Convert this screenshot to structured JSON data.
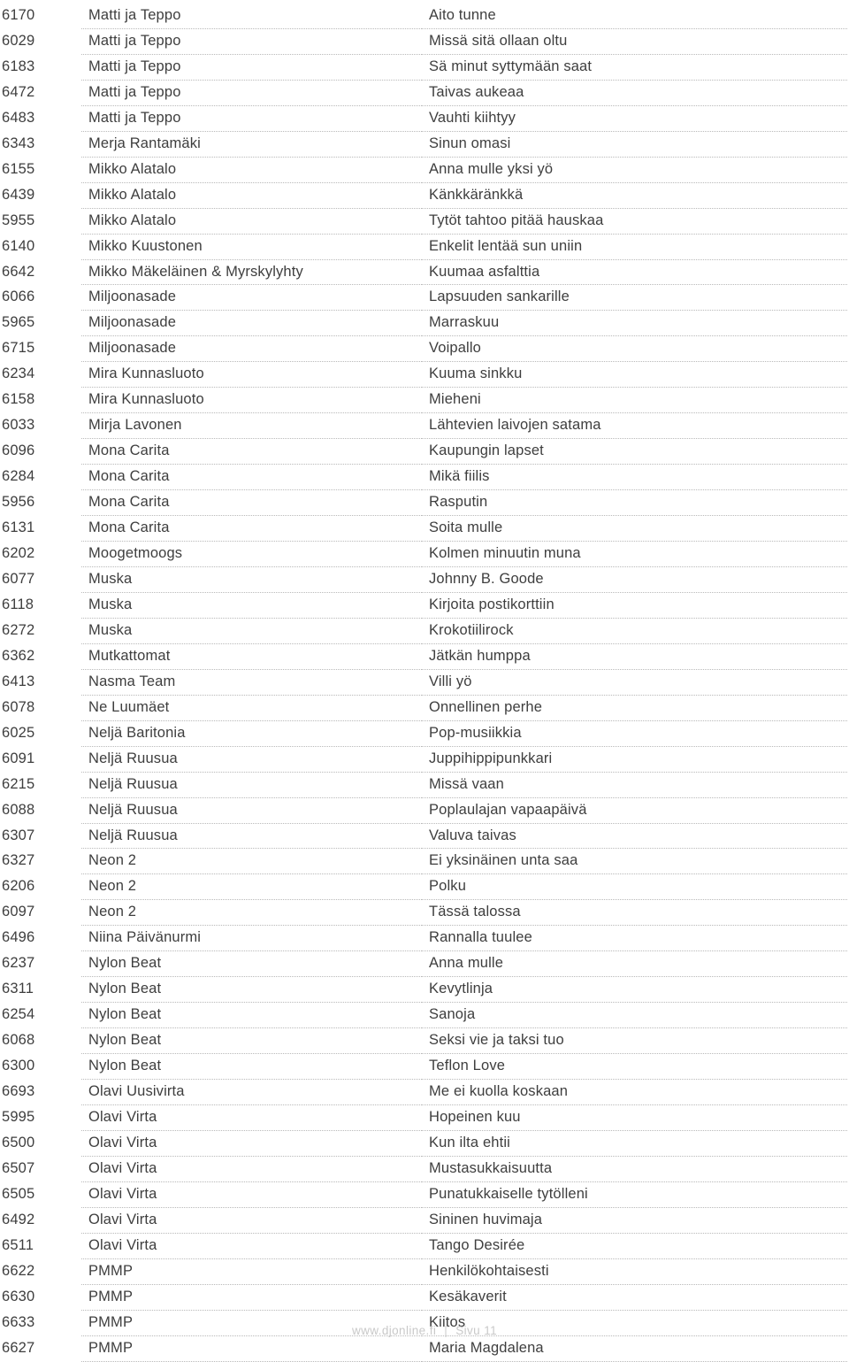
{
  "document": {
    "type": "karaoke-song-catalog",
    "columns": [
      "code",
      "artist",
      "title"
    ]
  },
  "rows": [
    {
      "code": "6170",
      "artist": "Matti ja Teppo",
      "title": "Aito tunne"
    },
    {
      "code": "6029",
      "artist": "Matti ja Teppo",
      "title": "Missä sitä ollaan oltu"
    },
    {
      "code": "6183",
      "artist": "Matti ja Teppo",
      "title": "Sä minut syttymään saat"
    },
    {
      "code": "6472",
      "artist": "Matti ja Teppo",
      "title": "Taivas aukeaa"
    },
    {
      "code": "6483",
      "artist": "Matti ja Teppo",
      "title": "Vauhti kiihtyy"
    },
    {
      "code": "6343",
      "artist": "Merja Rantamäki",
      "title": "Sinun omasi"
    },
    {
      "code": "6155",
      "artist": "Mikko Alatalo",
      "title": "Anna mulle yksi yö"
    },
    {
      "code": "6439",
      "artist": "Mikko Alatalo",
      "title": "Känkkäränkkä"
    },
    {
      "code": "5955",
      "artist": "Mikko Alatalo",
      "title": "Tytöt tahtoo pitää hauskaa"
    },
    {
      "code": "6140",
      "artist": "Mikko Kuustonen",
      "title": "Enkelit lentää sun uniin"
    },
    {
      "code": "6642",
      "artist": "Mikko Mäkeläinen & Myrskylyhty",
      "title": "Kuumaa asfalttia"
    },
    {
      "code": "6066",
      "artist": "Miljoonasade",
      "title": "Lapsuuden sankarille"
    },
    {
      "code": "5965",
      "artist": "Miljoonasade",
      "title": "Marraskuu"
    },
    {
      "code": "6715",
      "artist": "Miljoonasade",
      "title": "Voipallo"
    },
    {
      "code": "6234",
      "artist": "Mira Kunnasluoto",
      "title": "Kuuma sinkku"
    },
    {
      "code": "6158",
      "artist": "Mira Kunnasluoto",
      "title": "Mieheni"
    },
    {
      "code": "6033",
      "artist": "Mirja Lavonen",
      "title": "Lähtevien laivojen satama"
    },
    {
      "code": "6096",
      "artist": "Mona Carita",
      "title": "Kaupungin lapset"
    },
    {
      "code": "6284",
      "artist": "Mona Carita",
      "title": "Mikä fiilis"
    },
    {
      "code": "5956",
      "artist": "Mona Carita",
      "title": "Rasputin"
    },
    {
      "code": "6131",
      "artist": "Mona Carita",
      "title": "Soita mulle"
    },
    {
      "code": "6202",
      "artist": "Moogetmoogs",
      "title": "Kolmen minuutin muna"
    },
    {
      "code": "6077",
      "artist": "Muska",
      "title": "Johnny B. Goode"
    },
    {
      "code": "6118",
      "artist": "Muska",
      "title": "Kirjoita postikorttiin"
    },
    {
      "code": "6272",
      "artist": "Muska",
      "title": "Krokotiilirock"
    },
    {
      "code": "6362",
      "artist": "Mutkattomat",
      "title": "Jätkän humppa"
    },
    {
      "code": "6413",
      "artist": "Nasma Team",
      "title": "Villi yö"
    },
    {
      "code": "6078",
      "artist": "Ne Luumäet",
      "title": "Onnellinen perhe"
    },
    {
      "code": "6025",
      "artist": "Neljä Baritonia",
      "title": "Pop-musiikkia"
    },
    {
      "code": "6091",
      "artist": "Neljä Ruusua",
      "title": "Juppihippipunkkari"
    },
    {
      "code": "6215",
      "artist": "Neljä Ruusua",
      "title": "Missä vaan"
    },
    {
      "code": "6088",
      "artist": "Neljä Ruusua",
      "title": "Poplaulajan vapaapäivä"
    },
    {
      "code": "6307",
      "artist": "Neljä Ruusua",
      "title": "Valuva taivas"
    },
    {
      "code": "6327",
      "artist": "Neon 2",
      "title": "Ei yksinäinen unta saa"
    },
    {
      "code": "6206",
      "artist": "Neon 2",
      "title": "Polku"
    },
    {
      "code": "6097",
      "artist": "Neon 2",
      "title": "Tässä talossa"
    },
    {
      "code": "6496",
      "artist": "Niina Päivänurmi",
      "title": "Rannalla tuulee"
    },
    {
      "code": "6237",
      "artist": "Nylon Beat",
      "title": "Anna mulle"
    },
    {
      "code": "6311",
      "artist": "Nylon Beat",
      "title": "Kevytlinja"
    },
    {
      "code": "6254",
      "artist": "Nylon Beat",
      "title": "Sanoja"
    },
    {
      "code": "6068",
      "artist": "Nylon Beat",
      "title": "Seksi vie ja taksi tuo"
    },
    {
      "code": "6300",
      "artist": "Nylon Beat",
      "title": "Teflon Love"
    },
    {
      "code": "6693",
      "artist": "Olavi Uusivirta",
      "title": "Me ei kuolla koskaan"
    },
    {
      "code": "5995",
      "artist": "Olavi Virta",
      "title": "Hopeinen kuu"
    },
    {
      "code": "6500",
      "artist": "Olavi Virta",
      "title": "Kun ilta ehtii"
    },
    {
      "code": "6507",
      "artist": "Olavi Virta",
      "title": "Mustasukkaisuutta"
    },
    {
      "code": "6505",
      "artist": "Olavi Virta",
      "title": "Punatukkaiselle tytölleni"
    },
    {
      "code": "6492",
      "artist": "Olavi Virta",
      "title": "Sininen huvimaja"
    },
    {
      "code": "6511",
      "artist": "Olavi Virta",
      "title": "Tango Desirée"
    },
    {
      "code": "6622",
      "artist": "PMMP",
      "title": "Henkilökohtaisesti"
    },
    {
      "code": "6630",
      "artist": "PMMP",
      "title": "Kesäkaverit"
    },
    {
      "code": "6633",
      "artist": "PMMP",
      "title": "Kiitos"
    },
    {
      "code": "6627",
      "artist": "PMMP",
      "title": "Maria Magdalena"
    }
  ],
  "footer": {
    "site": "www.djonline.fi",
    "separator": "|",
    "page_label": "Sivu 11"
  },
  "colors": {
    "text": "#3e3e3e",
    "rule": "#b9b9b9",
    "footer_text": "#c9c9c9",
    "background": "#ffffff"
  }
}
